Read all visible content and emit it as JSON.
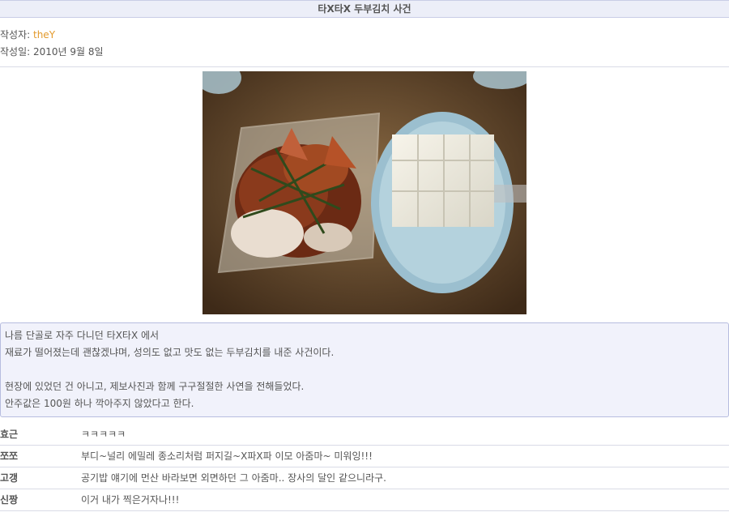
{
  "post": {
    "title": "타X타X 두부김치 사건",
    "author_label": "작성자:",
    "author": "theY",
    "date_label": "작성일:",
    "date": "2010년 9월 8일"
  },
  "story": {
    "lines": [
      "나름 단골로 자주 다니던 타X타X 에서",
      "재료가 떨어졌는데 괜찮겠냐며, 성의도 없고 맛도 없는 두부김치를 내준 사건이다.",
      "",
      "현장에 있었던 건 아니고, 제보사진과 함께 구구절절한 사연을 전해들었다.",
      "안주값은 100원 하나 깍아주지 않았다고 한다."
    ]
  },
  "comments": [
    {
      "name": "효근",
      "text": "ㅋㅋㅋㅋㅋ"
    },
    {
      "name": "쪼쪼",
      "text": "부디~널리 에밀레 종소리처럼 퍼지길~X파X파 이모 아줌마~ 미워잉!!!"
    },
    {
      "name": "고갱",
      "text": "공기밥 얘기에 먼산 바라보면 외면하던 그 아줌마.. 장사의 달인 같으니라구."
    },
    {
      "name": "신짱",
      "text": "이거 내가 찍은거자나!!!"
    }
  ]
}
